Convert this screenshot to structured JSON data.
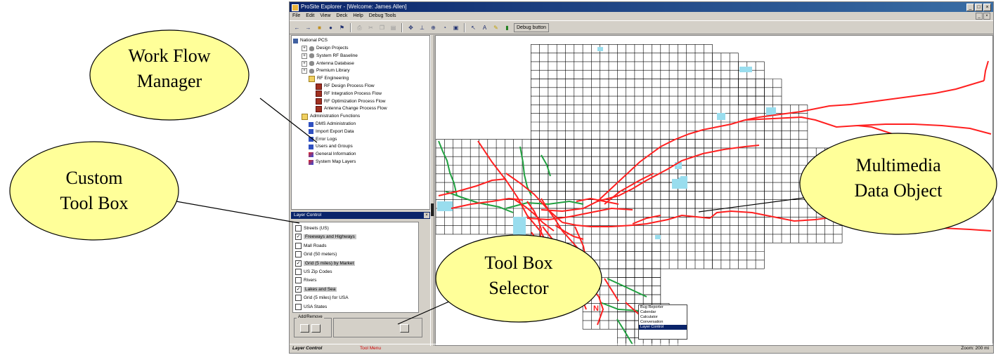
{
  "window": {
    "title": "ProSite Explorer - [Welcome: James Allen]",
    "menu": [
      "File",
      "Edit",
      "View",
      "Deck",
      "Help",
      "Debug Tools"
    ],
    "toolbar_button": "Debug button"
  },
  "tree": {
    "root": "National PCS",
    "items": [
      {
        "label": "Design Projects",
        "icon": "database-icon",
        "level": 1
      },
      {
        "label": "System RF Baseline",
        "icon": "database-icon",
        "level": 1
      },
      {
        "label": "Antenna Database",
        "icon": "database-icon",
        "level": 1
      },
      {
        "label": "Premium Library",
        "icon": "database-icon",
        "level": 1
      },
      {
        "label": "RF Engineering",
        "icon": "folder-icon",
        "level": 2
      },
      {
        "label": "RF Design Process Flow",
        "icon": "document-icon",
        "level": 3
      },
      {
        "label": "RF Integration Process Flow",
        "icon": "document-icon",
        "level": 3
      },
      {
        "label": "RF Optimization Process Flow",
        "icon": "document-icon",
        "level": 3
      },
      {
        "label": "Antenna Change Process Flow",
        "icon": "document-icon",
        "level": 3
      },
      {
        "label": "Administration Functions",
        "icon": "folder-icon",
        "level": 1
      },
      {
        "label": "DMS Administration",
        "icon": "page-icon",
        "level": 2
      },
      {
        "label": "Import Export Data",
        "icon": "page-icon",
        "level": 2
      },
      {
        "label": "Error Logs",
        "icon": "page-icon",
        "level": 2
      },
      {
        "label": "Users and Groups",
        "icon": "users-icon",
        "level": 2
      },
      {
        "label": "General Information",
        "icon": "info-icon",
        "level": 2
      },
      {
        "label": "System Map Layers",
        "icon": "map-layers-icon",
        "level": 2
      }
    ]
  },
  "layer_control": {
    "title": "Layer Control",
    "layers": [
      {
        "label": "Streets (US)",
        "checked": false,
        "selected": false
      },
      {
        "label": "Freeways and Highways",
        "checked": true,
        "selected": true
      },
      {
        "label": "Mall Roads",
        "checked": false,
        "selected": false
      },
      {
        "label": "Grid (50 meters)",
        "checked": false,
        "selected": false
      },
      {
        "label": "Grid (5 miles) by Market",
        "checked": true,
        "selected": true
      },
      {
        "label": "US Zip Codes",
        "checked": false,
        "selected": false
      },
      {
        "label": "Rivers",
        "checked": false,
        "selected": false
      },
      {
        "label": "Lakes and Sea",
        "checked": true,
        "selected": true
      },
      {
        "label": "Grid (5 miles) for USA",
        "checked": false,
        "selected": false
      },
      {
        "label": "USA States",
        "checked": false,
        "selected": false
      }
    ],
    "add_remove_label": "Add/Remove"
  },
  "toolbox_dropdown": {
    "options": [
      "Bug Reporter",
      "Calendar",
      "Calculator",
      "Conversation",
      "Layer Control"
    ],
    "selected_index": 4
  },
  "status": {
    "tab": "Layer Control",
    "tool": "Tool Menu",
    "zoom": "Zoom: 200 mi"
  },
  "callouts": {
    "workflow": [
      "Work Flow",
      "Manager"
    ],
    "custom_toolbox": [
      "Custom",
      "Tool Box"
    ],
    "toolbox_selector": [
      "Tool Box",
      "Selector"
    ],
    "multimedia": [
      "Multimedia",
      "Data Object"
    ]
  },
  "colors": {
    "callout_fill": "#ffff99",
    "highway": "#ff2020",
    "river": "#20a040",
    "water": "#99ddee",
    "title_bar": "#0a246a"
  }
}
